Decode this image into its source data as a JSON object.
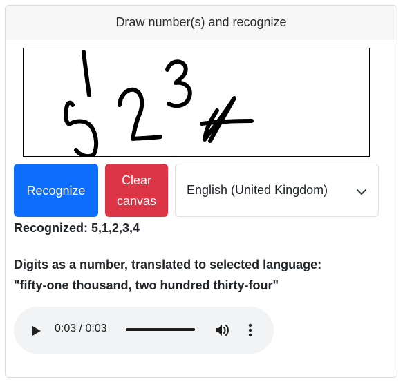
{
  "header": {
    "title": "Draw number(s) and recognize"
  },
  "controls": {
    "recognize_label": "Recognize",
    "clear_label_line1": "Clear",
    "clear_label_line2": "canvas",
    "language_selected": "English (United Kingdom)"
  },
  "result": {
    "recognized": "Recognized: 5,1,2,3,4",
    "translated_label": "Digits as a number, translated to selected language:",
    "translated_text": "\"fifty-one thousand, two hundred thirty-four\""
  },
  "audio": {
    "time": "0:03 / 0:03",
    "progress": 1.0
  },
  "icons": {
    "chevron": "chevron-down-icon",
    "play": "play-icon",
    "volume": "volume-icon",
    "menu": "more-vertical-icon"
  },
  "colors": {
    "primary": "#0d6efd",
    "danger": "#dc3545",
    "audio_bg": "#f1f3f4"
  }
}
